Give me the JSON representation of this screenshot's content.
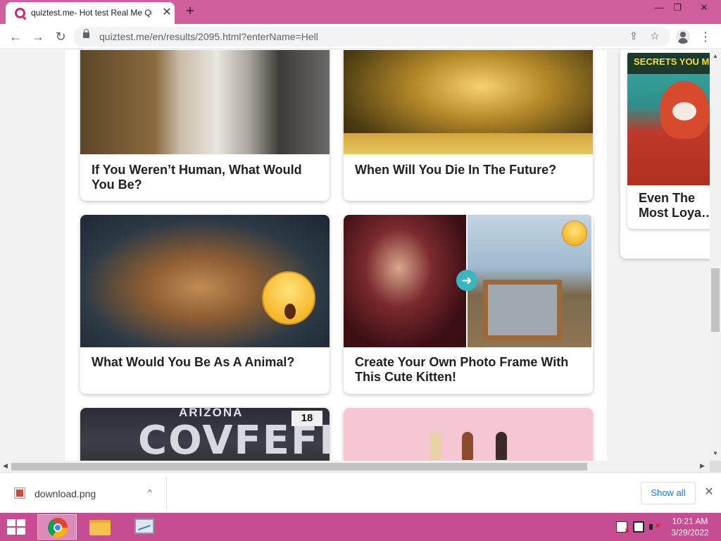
{
  "browser": {
    "tab_title": "quiztest.me- Hot test Real Me Qu",
    "tab_close": "✕",
    "new_tab": "+",
    "window_controls": {
      "minimize": "—",
      "restore": "❐",
      "close": "✕"
    },
    "url": "quiztest.me/en/results/2095.html?enterName=Hell",
    "nav": {
      "back": "←",
      "forward": "→",
      "reload": "↻"
    },
    "icons": [
      "share-icon",
      "star-icon",
      "profile-icon",
      "menu-icon"
    ]
  },
  "cards": [
    {
      "title": "If You Weren’t Human, What Would You Be?"
    },
    {
      "title": "When Will You Die In The Future?"
    },
    {
      "title": "What Would You Be As A Animal?"
    },
    {
      "title": "Create Your Own Photo Frame With This Cute Kitten!"
    },
    {
      "plate_text": "COVFEFE",
      "plate_state": "ARIZONA",
      "plate_num": "18"
    },
    {
      "title": ""
    }
  ],
  "sidebar": {
    "headline": "SECRETS YOU MISS",
    "title_line1": "Even The",
    "title_line2": "Most Loya…"
  },
  "download_bar": {
    "filename": "download.png",
    "show_all": "Show all",
    "close": "✕",
    "chevron": "^"
  },
  "taskbar": {
    "time": "10:21 AM",
    "date": "3/29/2022"
  },
  "colors": {
    "title_bar": "#ce5f9c",
    "taskbar": "#c74d92",
    "accent_link": "#1a73e8"
  }
}
